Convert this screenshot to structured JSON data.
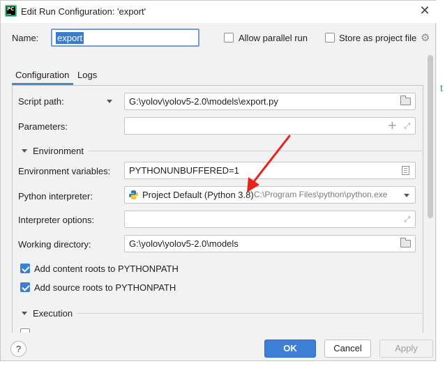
{
  "window": {
    "title": "Edit Run Configuration: 'export'",
    "app_icon_text": "PC"
  },
  "header": {
    "name_label": "Name:",
    "name_value": "export",
    "allow_parallel_label": "Allow parallel run",
    "allow_parallel_checked": false,
    "store_project_label": "Store as project file",
    "store_project_checked": false
  },
  "tabs": [
    {
      "label": "Configuration",
      "active": true
    },
    {
      "label": "Logs",
      "active": false
    }
  ],
  "form": {
    "script_path_label": "Script path:",
    "script_path_value": "G:\\yolov\\yolov5-2.0\\models\\export.py",
    "parameters_label": "Parameters:",
    "parameters_value": "",
    "environment_section": "Environment",
    "env_vars_label": "Environment variables:",
    "env_vars_value": "PYTHONUNBUFFERED=1",
    "interpreter_label": "Python interpreter:",
    "interpreter_value": "Project Default (Python 3.8)",
    "interpreter_path": "C:\\Program Files\\python\\python.exe",
    "interpreter_options_label": "Interpreter options:",
    "interpreter_options_value": "",
    "working_dir_label": "Working directory:",
    "working_dir_value": "G:\\yolov\\yolov5-2.0\\models",
    "add_content_roots_label": "Add content roots to PYTHONPATH",
    "add_content_roots_checked": true,
    "add_source_roots_label": "Add source roots to PYTHONPATH",
    "add_source_roots_checked": true,
    "execution_section": "Execution"
  },
  "footer": {
    "help_label": "?",
    "ok_label": "OK",
    "cancel_label": "Cancel",
    "apply_label": "Apply"
  },
  "colors": {
    "accent": "#3d7ed6",
    "annotation_arrow": "#e8231a"
  }
}
